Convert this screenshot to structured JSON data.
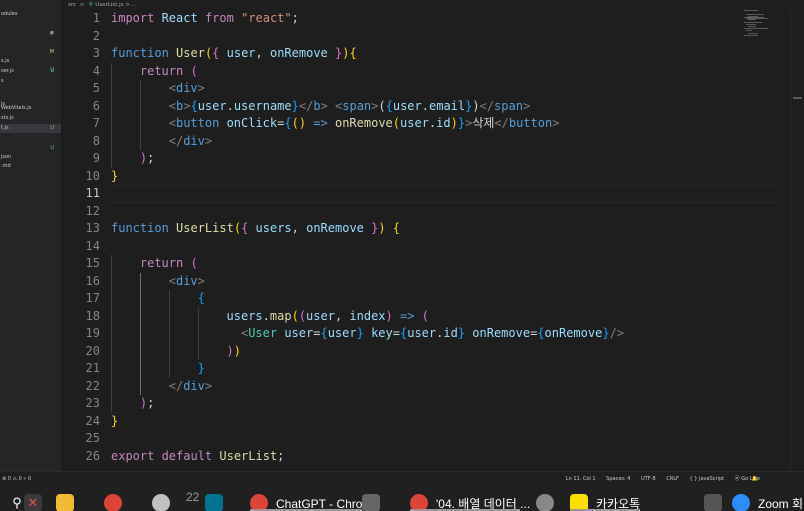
{
  "sidebar": {
    "items": [
      {
        "name": "odules",
        "badge": ""
      },
      {
        "name": "",
        "badge": "●"
      },
      {
        "name": "",
        "badge": "M"
      },
      {
        "name": "",
        "badge": "U"
      },
      {
        "name": "s.js",
        "badge": ""
      },
      {
        "name": "ser.js",
        "badge": "U"
      },
      {
        "name": "s",
        "badge": ""
      },
      {
        "name": "",
        "badge": ""
      },
      {
        "name": "js",
        "badge": ""
      },
      {
        "name": "WebVitals.js",
        "badge": ""
      },
      {
        "name": "sts.js",
        "badge": ""
      },
      {
        "name": "t.js",
        "badge": "U"
      },
      {
        "name": "",
        "badge": ""
      },
      {
        "name": "",
        "badge": "U"
      },
      {
        "name": "json",
        "badge": ""
      },
      {
        "name": ".md",
        "badge": ""
      }
    ]
  },
  "breadcrumb": {
    "folder": "src",
    "separator": ">",
    "file": "UserList.js",
    "tail": "> ..."
  },
  "editor": {
    "current_line": 11,
    "lines": [
      {
        "n": "1",
        "indent": 0,
        "tokens": [
          [
            "import ",
            "t-ctl"
          ],
          [
            "React ",
            "t-var"
          ],
          [
            "from ",
            "t-ctl"
          ],
          [
            "\"react\"",
            "t-str"
          ],
          [
            ";",
            "t-txt"
          ]
        ]
      },
      {
        "n": "2",
        "indent": 0,
        "tokens": []
      },
      {
        "n": "3",
        "indent": 0,
        "tokens": [
          [
            "function ",
            "t-kw"
          ],
          [
            "User",
            "t-fn"
          ],
          [
            "(",
            "t-b1"
          ],
          [
            "{ ",
            "t-b2"
          ],
          [
            "user",
            "t-var"
          ],
          [
            ", ",
            "t-txt"
          ],
          [
            "onRemove",
            "t-var"
          ],
          [
            " }",
            "t-b2"
          ],
          [
            ")",
            "t-b1"
          ],
          [
            "{",
            "t-b1"
          ]
        ]
      },
      {
        "n": "4",
        "indent": 1,
        "tokens": [
          [
            "return ",
            "t-ctl"
          ],
          [
            "(",
            "t-b2"
          ]
        ]
      },
      {
        "n": "5",
        "indent": 2,
        "tokens": [
          [
            "<",
            "t-pun"
          ],
          [
            "div",
            "t-tag"
          ],
          [
            ">",
            "t-pun"
          ]
        ]
      },
      {
        "n": "6",
        "indent": 2,
        "tokens": [
          [
            "<",
            "t-pun"
          ],
          [
            "b",
            "t-tag"
          ],
          [
            ">",
            "t-pun"
          ],
          [
            "{",
            "t-b3"
          ],
          [
            "user",
            "t-var"
          ],
          [
            ".",
            "t-txt"
          ],
          [
            "username",
            "t-var"
          ],
          [
            "}",
            "t-b3"
          ],
          [
            "</",
            "t-pun"
          ],
          [
            "b",
            "t-tag"
          ],
          [
            ">",
            "t-pun"
          ],
          [
            " ",
            "t-txt"
          ],
          [
            "<",
            "t-pun"
          ],
          [
            "span",
            "t-tag"
          ],
          [
            ">",
            "t-pun"
          ],
          [
            "(",
            "t-txt"
          ],
          [
            "{",
            "t-b3"
          ],
          [
            "user",
            "t-var"
          ],
          [
            ".",
            "t-txt"
          ],
          [
            "email",
            "t-var"
          ],
          [
            "}",
            "t-b3"
          ],
          [
            ")",
            "t-txt"
          ],
          [
            "</",
            "t-pun"
          ],
          [
            "span",
            "t-tag"
          ],
          [
            ">",
            "t-pun"
          ]
        ]
      },
      {
        "n": "7",
        "indent": 2,
        "tokens": [
          [
            "<",
            "t-pun"
          ],
          [
            "button ",
            "t-tag"
          ],
          [
            "onClick",
            "t-attr"
          ],
          [
            "=",
            "t-txt"
          ],
          [
            "{",
            "t-b3"
          ],
          [
            "() ",
            "t-b1"
          ],
          [
            "=> ",
            "t-kw"
          ],
          [
            "onRemove",
            "t-fn"
          ],
          [
            "(",
            "t-b1"
          ],
          [
            "user",
            "t-var"
          ],
          [
            ".",
            "t-txt"
          ],
          [
            "id",
            "t-var"
          ],
          [
            ")",
            "t-b1"
          ],
          [
            "}",
            "t-b3"
          ],
          [
            ">",
            "t-pun"
          ],
          [
            "삭제",
            "t-txt"
          ],
          [
            "</",
            "t-pun"
          ],
          [
            "button",
            "t-tag"
          ],
          [
            ">",
            "t-pun"
          ]
        ]
      },
      {
        "n": "8",
        "indent": 2,
        "tokens": [
          [
            "</",
            "t-pun"
          ],
          [
            "div",
            "t-tag"
          ],
          [
            ">",
            "t-pun"
          ]
        ]
      },
      {
        "n": "9",
        "indent": 1,
        "tokens": [
          [
            ")",
            "t-b2"
          ],
          [
            ";",
            "t-txt"
          ]
        ]
      },
      {
        "n": "10",
        "indent": 0,
        "tokens": [
          [
            "}",
            "t-b1"
          ]
        ]
      },
      {
        "n": "11",
        "indent": 0,
        "tokens": []
      },
      {
        "n": "12",
        "indent": 0,
        "tokens": []
      },
      {
        "n": "13",
        "indent": 0,
        "tokens": [
          [
            "function ",
            "t-kw"
          ],
          [
            "UserList",
            "t-fn"
          ],
          [
            "(",
            "t-b1"
          ],
          [
            "{ ",
            "t-b2"
          ],
          [
            "users",
            "t-var"
          ],
          [
            ", ",
            "t-txt"
          ],
          [
            "onRemove",
            "t-var"
          ],
          [
            " }",
            "t-b2"
          ],
          [
            ") ",
            "t-b1"
          ],
          [
            "{",
            "t-b1"
          ]
        ]
      },
      {
        "n": "14",
        "indent": 0,
        "tokens": []
      },
      {
        "n": "15",
        "indent": 1,
        "tokens": [
          [
            "return ",
            "t-ctl"
          ],
          [
            "(",
            "t-b2"
          ]
        ]
      },
      {
        "n": "16",
        "indent": 2,
        "tokens": [
          [
            "<",
            "t-pun"
          ],
          [
            "div",
            "t-tag"
          ],
          [
            ">",
            "t-pun"
          ]
        ]
      },
      {
        "n": "17",
        "indent": 3,
        "tokens": [
          [
            "{",
            "t-b3"
          ]
        ]
      },
      {
        "n": "18",
        "indent": 4,
        "tokens": [
          [
            "users",
            "t-var"
          ],
          [
            ".",
            "t-txt"
          ],
          [
            "map",
            "t-fn"
          ],
          [
            "(",
            "t-b1"
          ],
          [
            "(",
            "t-b2"
          ],
          [
            "user",
            "t-var"
          ],
          [
            ", ",
            "t-txt"
          ],
          [
            "index",
            "t-var"
          ],
          [
            ") ",
            "t-b2"
          ],
          [
            "=> ",
            "t-kw"
          ],
          [
            "(",
            "t-b2"
          ]
        ]
      },
      {
        "n": "19",
        "indent": 4,
        "tokens": [
          [
            "  ",
            "t-txt"
          ],
          [
            "<",
            "t-pun"
          ],
          [
            "User ",
            "t-comp"
          ],
          [
            "user",
            "t-attr"
          ],
          [
            "=",
            "t-txt"
          ],
          [
            "{",
            "t-b3"
          ],
          [
            "user",
            "t-var"
          ],
          [
            "} ",
            "t-b3"
          ],
          [
            "key",
            "t-attr"
          ],
          [
            "=",
            "t-txt"
          ],
          [
            "{",
            "t-b3"
          ],
          [
            "user",
            "t-var"
          ],
          [
            ".",
            "t-txt"
          ],
          [
            "id",
            "t-var"
          ],
          [
            "} ",
            "t-b3"
          ],
          [
            "onRemove",
            "t-attr"
          ],
          [
            "=",
            "t-txt"
          ],
          [
            "{",
            "t-b3"
          ],
          [
            "onRemove",
            "t-var"
          ],
          [
            "}",
            "t-b3"
          ],
          [
            "/>",
            "t-pun"
          ]
        ]
      },
      {
        "n": "20",
        "indent": 4,
        "tokens": [
          [
            ")",
            "t-b2"
          ],
          [
            ")",
            "t-b1"
          ]
        ]
      },
      {
        "n": "21",
        "indent": 3,
        "tokens": [
          [
            "}",
            "t-b3"
          ]
        ]
      },
      {
        "n": "22",
        "indent": 2,
        "tokens": [
          [
            "</",
            "t-pun"
          ],
          [
            "div",
            "t-tag"
          ],
          [
            ">",
            "t-pun"
          ]
        ]
      },
      {
        "n": "23",
        "indent": 1,
        "tokens": [
          [
            ")",
            "t-b2"
          ],
          [
            ";",
            "t-txt"
          ]
        ]
      },
      {
        "n": "24",
        "indent": 0,
        "tokens": [
          [
            "}",
            "t-b1"
          ]
        ]
      },
      {
        "n": "25",
        "indent": 0,
        "tokens": []
      },
      {
        "n": "26",
        "indent": 0,
        "tokens": [
          [
            "export ",
            "t-ctl"
          ],
          [
            "default ",
            "t-ctl"
          ],
          [
            "UserList",
            "t-fn"
          ],
          [
            ";",
            "t-txt"
          ]
        ]
      }
    ]
  },
  "statusbar": {
    "left": "⊗ 0 ⚠ 0   ⑂ 0",
    "position": "Ln 11, Col 1",
    "spaces": "Spaces: 4",
    "encoding": "UTF-8",
    "eol": "CRLF",
    "language": "{ } JavaScript",
    "golive": "⦿ Go Live",
    "bell": "🔔"
  },
  "taskbar": {
    "items": [
      {
        "name": "search",
        "label": ""
      },
      {
        "name": "camera",
        "label": ""
      },
      {
        "name": "file-explorer",
        "label": ""
      },
      {
        "name": "chrome",
        "label": ""
      },
      {
        "name": "app",
        "label": "22"
      },
      {
        "name": "mysql-workbench",
        "label": ""
      },
      {
        "name": "chrome-chatgpt",
        "label": "ChatGPT - Chrome"
      },
      {
        "name": "document",
        "label": ""
      },
      {
        "name": "chrome-array",
        "label": "'04. 배열 데이터 ..."
      },
      {
        "name": "emoji",
        "label": ""
      },
      {
        "name": "kakaotalk",
        "label": "카카오톡"
      },
      {
        "name": "screen",
        "label": ""
      },
      {
        "name": "zoom",
        "label": "Zoom 회"
      }
    ]
  },
  "colors": {
    "editor_bg": "#1e1e1e",
    "sidebar_bg": "#252526",
    "taskbar_bg": "#202020",
    "kakao": "#fae100",
    "zoom": "#2d8cff",
    "mysql": "#00758f"
  }
}
